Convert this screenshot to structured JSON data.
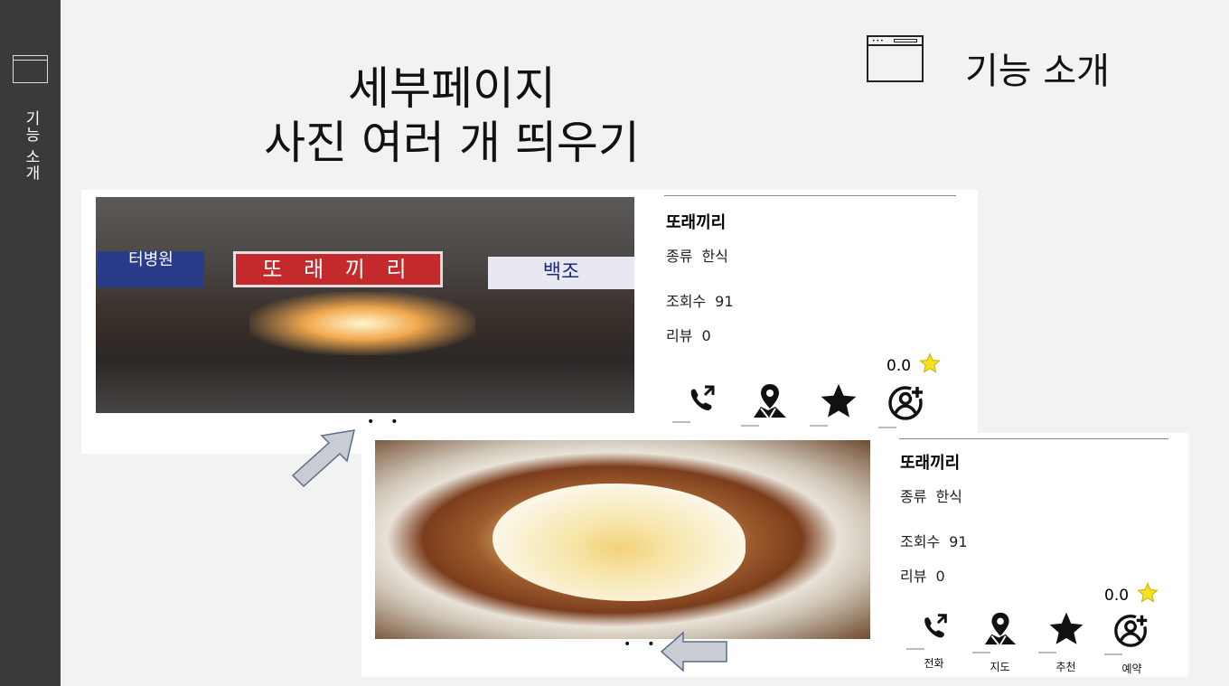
{
  "sidebar": {
    "label": "기능 소개"
  },
  "title": {
    "line1": "세부페이지",
    "line2": "사진 여러 개 띄우기"
  },
  "header": {
    "feature_title": "기능 소개"
  },
  "colors": {
    "sidebar_bg": "#3a3a3a",
    "star": "#f5e11f",
    "sign_red": "#c4292c"
  },
  "card1": {
    "restaurant_name": "또래끼리",
    "category_label": "종류",
    "category_value": "한식",
    "views_label": "조회수",
    "views_value": "91",
    "reviews_label": "리뷰",
    "reviews_value": "0",
    "rating": "0.0",
    "photo_sign": "또 래 끼 리",
    "photo_sign_left": "터병원",
    "photo_sign_right": "백조",
    "photo_dots": "••",
    "icons": [
      "phone-icon",
      "map-icon",
      "star-icon",
      "add-user-icon"
    ]
  },
  "card2": {
    "restaurant_name": "또래끼리",
    "category_label": "종류",
    "category_value": "한식",
    "views_label": "조회수",
    "views_value": "91",
    "reviews_label": "리뷰",
    "reviews_value": "0",
    "rating": "0.0",
    "photo_dots": "••",
    "actions": [
      {
        "icon": "phone-icon",
        "label": "전화"
      },
      {
        "icon": "map-icon",
        "label": "지도"
      },
      {
        "icon": "star-icon",
        "label": "추천"
      },
      {
        "icon": "add-user-icon",
        "label": "예약"
      }
    ]
  }
}
